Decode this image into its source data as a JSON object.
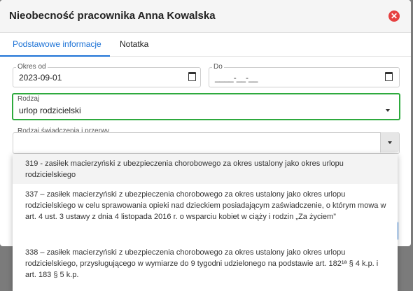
{
  "modal": {
    "title": "Nieobecność pracownika Anna Kowalska"
  },
  "tabs": [
    {
      "label": "Podstawowe informacje",
      "active": true
    },
    {
      "label": "Notatka",
      "active": false
    }
  ],
  "fields": {
    "okres_od": {
      "label": "Okres od",
      "value": "2023-09-01"
    },
    "do": {
      "label": "Do",
      "value": "____-__-__"
    },
    "rodzaj": {
      "label": "Rodzaj",
      "value": "urlop rodzicielski"
    },
    "rodzaj_swiadczenia": {
      "label": "Rodzaj świadczenia i przerwy",
      "value": ""
    }
  },
  "dropdown_options": [
    {
      "text": "319 - zasiłek macierzyński z ubezpieczenia chorobowego za okres ustalony jako okres urlopu rodzicielskiego",
      "highlighted": true
    },
    {
      "text": "337 – zasiłek macierzyński z ubezpieczenia chorobowego za okres ustalony jako okres urlopu rodzicielskiego w celu sprawowania opieki nad dzieckiem posiadającym zaświadczenie, o którym mowa w art. 4 ust. 3 ustawy z dnia 4 listopada 2016 r. o wsparciu kobiet w ciąży i rodzin „Za życiem”",
      "highlighted": false
    },
    {
      "text": "338 – zasiłek macierzyński z ubezpieczenia chorobowego za okres ustalony jako okres urlopu rodzicielskiego, przysługującego w wymiarze do 9 tygodni udzielonego na podstawie art. 182¹ª § 4 k.p. i art. 183 § 5 k.p.",
      "highlighted": false
    }
  ],
  "colors": {
    "accent": "#1e73d6",
    "valid_border": "#2eaa3e",
    "close": "#e64040"
  },
  "icons": {
    "close": "close-circle-icon",
    "calendar": "calendar-icon",
    "dropdown": "chevron-down-icon"
  }
}
